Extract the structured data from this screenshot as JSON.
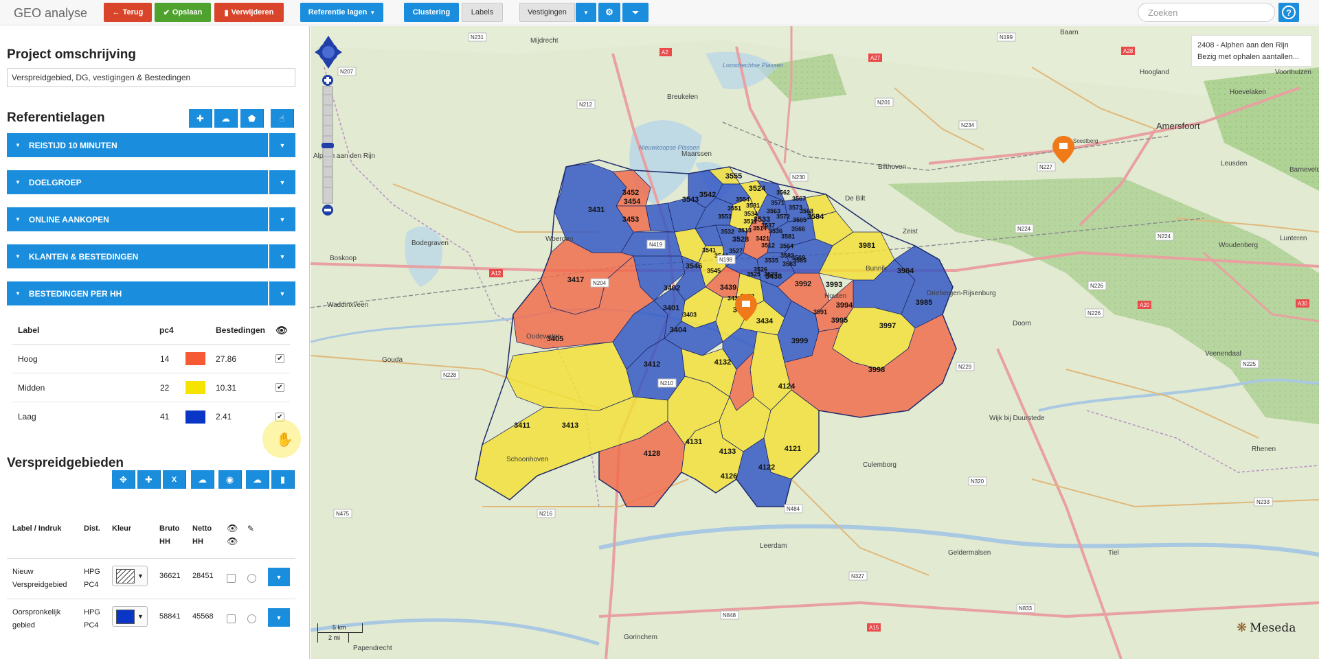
{
  "app": {
    "title": "GEO analyse",
    "buttons": {
      "back": "Terug",
      "save": "Opslaan",
      "delete": "Verwijderen",
      "reference_layers": "Referentie lagen",
      "clustering": "Clustering",
      "labels": "Labels",
      "locations": "Vestigingen"
    },
    "search_placeholder": "Zoeken"
  },
  "sidebar": {
    "project_heading": "Project omschrijving",
    "project_description": "Verspreidgebied, DG, vestigingen & Bestedingen",
    "reference_heading": "Referentielagen",
    "layers": [
      {
        "label": "REISTIJD 10 MINUTEN"
      },
      {
        "label": "DOELGROEP"
      },
      {
        "label": "ONLINE AANKOPEN"
      },
      {
        "label": "KLANTEN & BESTEDINGEN"
      },
      {
        "label": "BESTEDINGEN PER HH"
      }
    ],
    "legend": {
      "headers": {
        "label": "Label",
        "pc4": "pc4",
        "spending": "Bestedingen"
      },
      "rows": [
        {
          "label": "Hoog",
          "pc4": "14",
          "color": "#f55a35",
          "spending": "27.86",
          "visible": true
        },
        {
          "label": "Midden",
          "pc4": "22",
          "color": "#f5e300",
          "spending": "10.31",
          "visible": true
        },
        {
          "label": "Laag",
          "pc4": "41",
          "color": "#0a36c8",
          "spending": "2.41",
          "visible": true
        }
      ]
    },
    "distribution_heading": "Verspreidgebieden",
    "distribution_table": {
      "headers": {
        "label": "Label / Indruk",
        "dist": "Dist.",
        "color": "Kleur",
        "gross": "Bruto",
        "gross2": "HH",
        "net": "Netto",
        "net2": "HH"
      },
      "rows": [
        {
          "label1": "Nieuw",
          "label2": "Verspreidgebied",
          "dist1": "HPG",
          "dist2": "PC4",
          "pattern": "hatched",
          "gross": "36621",
          "net": "28451"
        },
        {
          "label1": "Oorspronkelijk",
          "label2": "gebied",
          "dist1": "HPG",
          "dist2": "PC4",
          "color": "#0a36c8",
          "gross": "58841",
          "net": "45568"
        }
      ]
    }
  },
  "map": {
    "status_line1": "2408 - Alphen aan den Rijn",
    "status_line2": "Bezig met ophalen aantallen...",
    "scale_km": "5 km",
    "scale_mi": "2 mi",
    "brand": "Meseda",
    "colors": {
      "hoog": "#f26a4b",
      "midden": "#f3e036",
      "laag": "#2f55c4"
    },
    "places": [
      "Mijdrecht",
      "Breukelen",
      "Maarssen",
      "Bilthoven",
      "De Bilt",
      "Zeist",
      "Woerden",
      "Bodegraven",
      "Boskoop",
      "Waddinxveen",
      "Gouda",
      "Oudewater",
      "Schoonhoven",
      "Alphen aan den Rijn",
      "Nieuwkoopse Plassen",
      "Loosdrechtse Plassen",
      "Baarn",
      "Hoogland",
      "Hoevelaken",
      "Amersfoort",
      "Leusden",
      "Woudenberg",
      "Barneveld",
      "Driebergen-Rijsenburg",
      "Bunnik",
      "Houten",
      "Doorn",
      "Veenendaal",
      "Wijk bij Duurstede",
      "Culemborg",
      "Leerdam",
      "Geldermalsen",
      "Tiel",
      "Rhenen",
      "Gorinchem",
      "Papendrecht",
      "Voorthuizen",
      "Lunteren",
      "Soestberg"
    ],
    "postcodes": [
      "3431",
      "3452",
      "3454",
      "3453",
      "3542",
      "3555",
      "3524",
      "3543",
      "3533",
      "3584",
      "3546",
      "3528",
      "3417",
      "3402",
      "3438",
      "3439",
      "3992",
      "3993",
      "3981",
      "3984",
      "3405",
      "3401",
      "3404",
      "3434",
      "3433",
      "3994",
      "3995",
      "3985",
      "3997",
      "3412",
      "3999",
      "3998",
      "3411",
      "3413",
      "4132",
      "4124",
      "4131",
      "4133",
      "4121",
      "4128",
      "4126",
      "4122",
      "3526",
      "3582",
      "3583",
      "3535",
      "3531",
      "3571",
      "3573",
      "3581",
      "3572",
      "3523",
      "3545",
      "3527",
      "3991",
      "3432",
      "3435",
      "3403",
      "3421",
      "3525",
      "3541",
      "3544",
      "3551",
      "3553",
      "3554",
      "3513",
      "3514",
      "3511",
      "3512",
      "3532",
      "3534",
      "3536",
      "3537",
      "3562",
      "3563",
      "3564",
      "3565",
      "3566",
      "3567",
      "3568",
      "3569",
      "3585"
    ],
    "roads": [
      "N231",
      "N207",
      "N212",
      "N201",
      "N199",
      "A28",
      "A27",
      "N234",
      "A2",
      "N230",
      "N229",
      "N210",
      "A12",
      "A20",
      "N204",
      "N228",
      "N216",
      "N484",
      "N320",
      "N833",
      "N327",
      "N848",
      "A15",
      "N233",
      "N226",
      "N227",
      "N224",
      "N225",
      "N224",
      "A30",
      "N475",
      "N419",
      "N198",
      "N226"
    ]
  }
}
